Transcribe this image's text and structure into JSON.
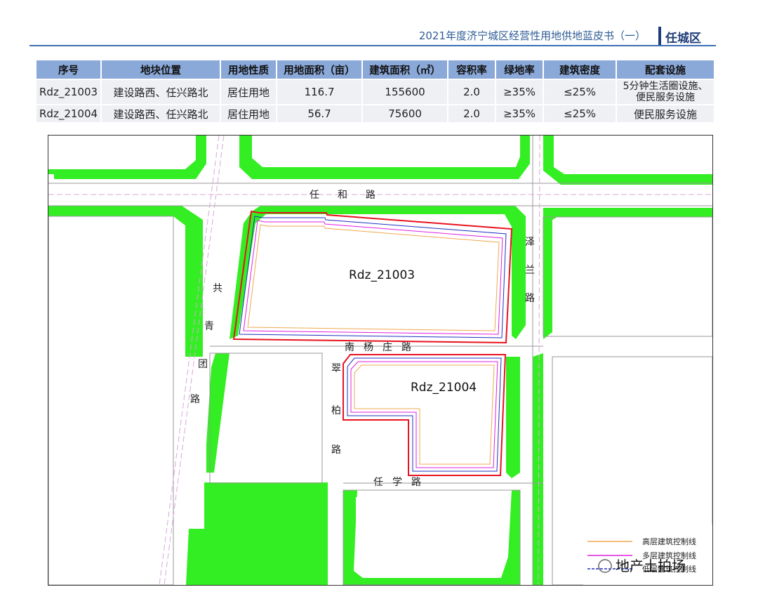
{
  "header": {
    "title": "2021年度济宁城区经营性用地供地蓝皮书（一）",
    "district": "任城区"
  },
  "table": {
    "headers": [
      "序号",
      "地块位置",
      "用地性质",
      "用地面积（亩）",
      "建筑面积（㎡）",
      "容积率",
      "绿地率",
      "建筑密度",
      "配套设施"
    ],
    "rows": [
      {
        "id": "Rdz_21003",
        "location": "建设路西、任兴路北",
        "use": "居住用地",
        "area_mu": "116.7",
        "floor_area": "155600",
        "far": "2.0",
        "green": "≥35%",
        "density": "≤25%",
        "facility_1": "5分钟生活圈设施、",
        "facility_2": "便民服务设施"
      },
      {
        "id": "Rdz_21004",
        "location": "建设路西、任兴路北",
        "use": "居住用地",
        "area_mu": "56.7",
        "floor_area": "75600",
        "far": "2.0",
        "green": "≥35%",
        "density": "≤25%",
        "facility": "便民服务设施"
      }
    ]
  },
  "map": {
    "roads": {
      "renhe": [
        "任",
        "和",
        "路"
      ],
      "nanyangzhuang": [
        "南",
        "杨",
        "庄",
        "路"
      ],
      "renxue": [
        "任",
        "学",
        "路"
      ],
      "zelan": [
        "泽",
        "兰",
        "路"
      ],
      "gongqingtuan": [
        "共",
        "青",
        "团",
        "路"
      ],
      "cuibai": [
        "翠",
        "柏",
        "路"
      ]
    },
    "parcels": [
      "Rdz_21003",
      "Rdz_21004"
    ],
    "legend": [
      "高层建筑控制线",
      "多层建筑控制线",
      "低层建筑控制线"
    ],
    "colors": {
      "green": "#33ee22",
      "red": "#e8131f",
      "orange": "#f0a850",
      "magenta": "#e020e0",
      "blue": "#2030c0"
    },
    "watermark": "地产土拍场"
  }
}
